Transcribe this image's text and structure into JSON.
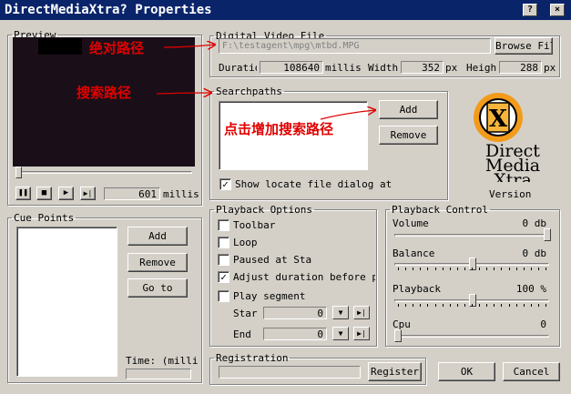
{
  "window": {
    "title": "DirectMediaXtra? Properties"
  },
  "preview": {
    "legend": "Preview",
    "time_value": "601",
    "time_unit": "millis"
  },
  "digital_video": {
    "legend": "Digital Video File",
    "path": "F:\\testagent\\mpg\\mtbd.MPG",
    "browse_label": "Browse File",
    "duration_label": "Duration",
    "duration_value": "108640",
    "duration_unit": "millis",
    "width_label": "Width",
    "width_value": "352",
    "width_unit": "px",
    "height_label": "Height",
    "height_value": "288",
    "height_unit": "px"
  },
  "searchpaths": {
    "legend": "Searchpaths",
    "add_label": "Add",
    "remove_label": "Remove",
    "show_locate_label": "Show locate file dialog at",
    "show_locate_checked": true
  },
  "logo": {
    "line1": "Direct",
    "line2": "Media",
    "line3": "Xtra",
    "version_label": "Version"
  },
  "cue_points": {
    "legend": "Cue Points",
    "add_label": "Add",
    "remove_label": "Remove",
    "goto_label": "Go to",
    "time_label": "Time: (millis"
  },
  "playback_options": {
    "legend": "Playback Options",
    "toolbar_label": "Toolbar",
    "loop_label": "Loop",
    "paused_label": "Paused at Sta",
    "adjust_label": "Adjust duration before pla",
    "play_segment_label": "Play segment",
    "start_label": "Star",
    "start_value": "0",
    "end_label": "End",
    "end_value": "0",
    "toolbar_checked": false,
    "loop_checked": false,
    "paused_checked": false,
    "adjust_checked": true,
    "segment_checked": false
  },
  "playback_control": {
    "legend": "Playback Control",
    "volume_label": "Volume",
    "volume_value": "0 db",
    "volume_level": 1.0,
    "balance_label": "Balance",
    "balance_value": "0 db",
    "balance_level": 0.5,
    "playback_label": "Playback",
    "playback_value": "100 %",
    "playback_level": 0.5,
    "cpu_label": "Cpu",
    "cpu_value": "0",
    "cpu_level": 0.0
  },
  "registration": {
    "legend": "Registration",
    "register_label": "Register"
  },
  "buttons": {
    "ok_label": "OK",
    "cancel_label": "Cancel"
  },
  "annotations": {
    "absolute_path": "绝对路径",
    "search_path": "搜索路径",
    "click_add": "点击增加搜索路径"
  },
  "colors": {
    "title_bg": "#0a246a",
    "annotation": "#e00000",
    "preview_bg": "#1a0f19"
  }
}
